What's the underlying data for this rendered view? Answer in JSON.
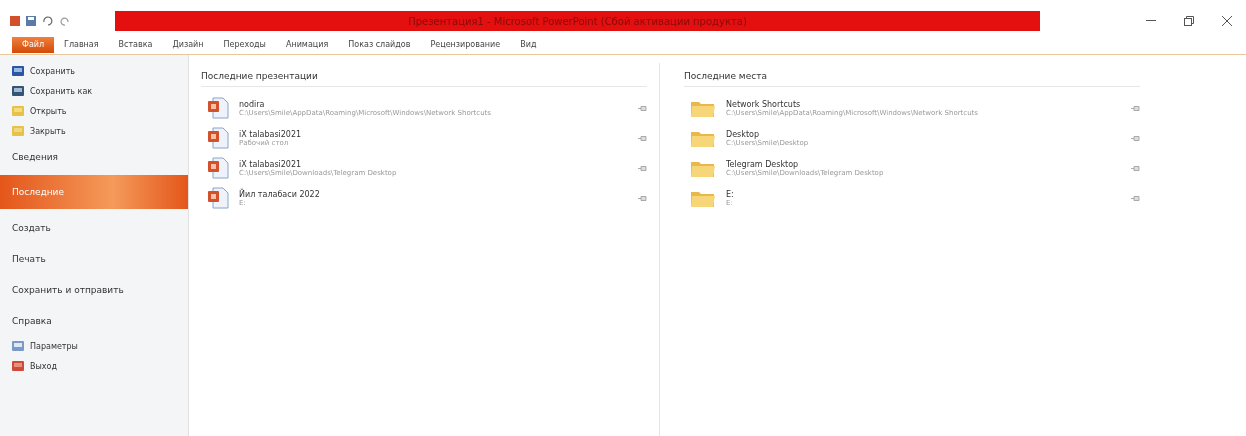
{
  "window": {
    "title": "Презентация1 - Microsoft PowerPoint (Сбой активации продукта)"
  },
  "tabs": [
    {
      "label": "Файл",
      "selected": true
    },
    {
      "label": "Главная",
      "selected": false
    },
    {
      "label": "Вставка",
      "selected": false
    },
    {
      "label": "Дизайн",
      "selected": false
    },
    {
      "label": "Переходы",
      "selected": false
    },
    {
      "label": "Анимация",
      "selected": false
    },
    {
      "label": "Показ слайдов",
      "selected": false
    },
    {
      "label": "Рецензирование",
      "selected": false
    },
    {
      "label": "Вид",
      "selected": false
    }
  ],
  "sidebar": {
    "items": [
      {
        "label": "Сохранить",
        "kind": "icon",
        "selected": false
      },
      {
        "label": "Сохранить как",
        "kind": "icon",
        "selected": false
      },
      {
        "label": "Открыть",
        "kind": "icon",
        "selected": false
      },
      {
        "label": "Закрыть",
        "kind": "icon",
        "selected": false
      },
      {
        "label": "Сведения",
        "kind": "section",
        "selected": false
      },
      {
        "label": "Последние",
        "kind": "section",
        "selected": true
      },
      {
        "label": "Создать",
        "kind": "section",
        "selected": false
      },
      {
        "label": "Печать",
        "kind": "section",
        "selected": false
      },
      {
        "label": "Сохранить и отправить",
        "kind": "section",
        "selected": false
      },
      {
        "label": "Справка",
        "kind": "section",
        "selected": false
      },
      {
        "label": "Параметры",
        "kind": "icon",
        "selected": false
      },
      {
        "label": "Выход",
        "kind": "icon",
        "selected": false
      }
    ]
  },
  "recent_presentations": {
    "title": "Последние презентации",
    "items": [
      {
        "name": "nodira",
        "path": "C:\\Users\\Smile\\AppData\\Roaming\\Microsoft\\Windows\\Network Shortcuts"
      },
      {
        "name": "iX talabasi2021",
        "path": "Рабочий стол"
      },
      {
        "name": "iX talabasi2021",
        "path": "C:\\Users\\Smile\\Downloads\\Telegram Desktop"
      },
      {
        "name": "Йил талабаси 2022",
        "path": "E:"
      }
    ]
  },
  "recent_places": {
    "title": "Последние места",
    "items": [
      {
        "name": "Network Shortcuts",
        "path": "C:\\Users\\Smile\\AppData\\Roaming\\Microsoft\\Windows\\Network Shortcuts"
      },
      {
        "name": "Desktop",
        "path": "C:\\Users\\Smile\\Desktop"
      },
      {
        "name": "Telegram Desktop",
        "path": "C:\\Users\\Smile\\Downloads\\Telegram Desktop"
      },
      {
        "name": "E:",
        "path": "E:"
      }
    ]
  }
}
